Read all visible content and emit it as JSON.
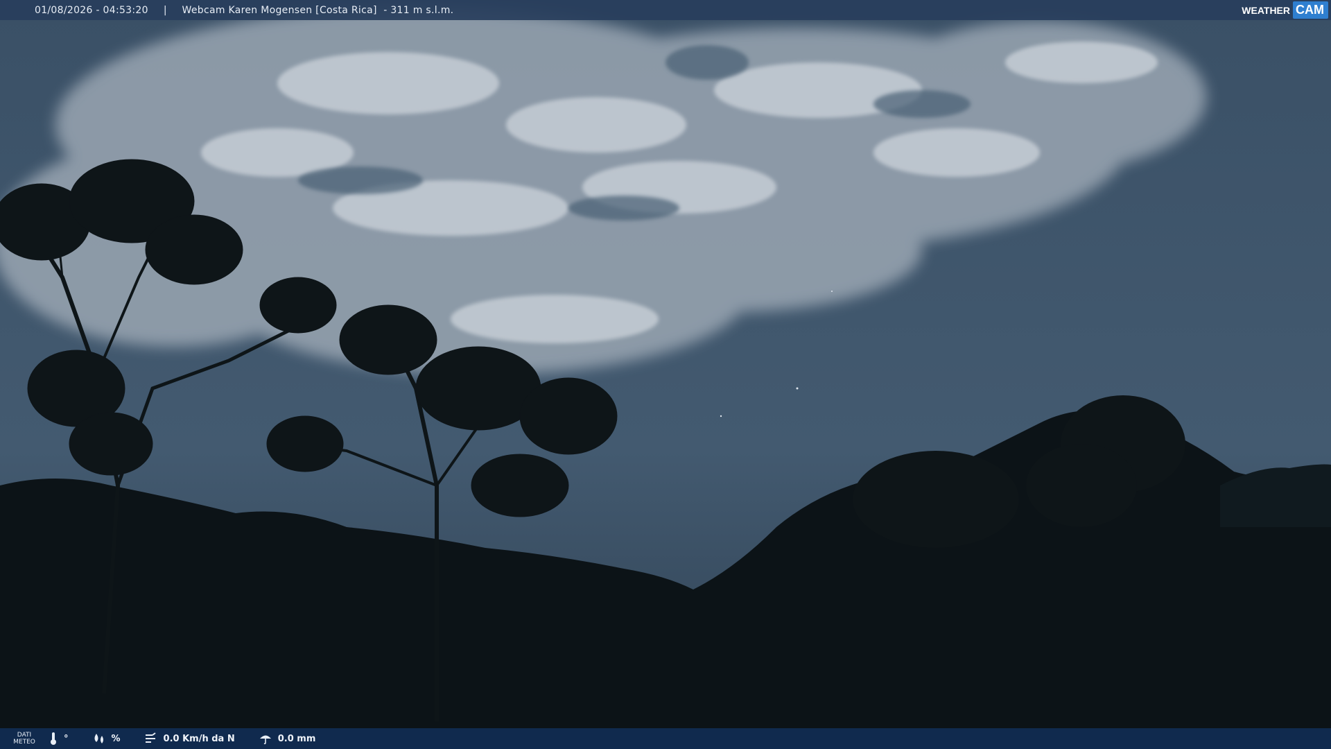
{
  "header": {
    "timestamp": "01/08/2026 - 04:53:20",
    "separator": "|",
    "title": "Webcam Karen Mogensen [Costa Rica]  - 311 m s.l.m.",
    "brand_weather": "WEATHER",
    "brand_cam": "CAM"
  },
  "footer": {
    "dati_label_1": "DATI",
    "dati_label_2": "METEO",
    "temperature": "°",
    "humidity": "%",
    "wind": "0.0 Km/h da N",
    "rain": "0.0 mm"
  },
  "colors": {
    "sky": "#3e5368",
    "header_bg": "#283e5c",
    "footer_bg": "#0e284e",
    "brand_accent": "#2f7fd0"
  },
  "icons": {
    "temperature": "thermometer-icon",
    "humidity": "humidity-drops-icon",
    "wind": "wind-icon",
    "rain": "rain-umbrella-icon"
  }
}
